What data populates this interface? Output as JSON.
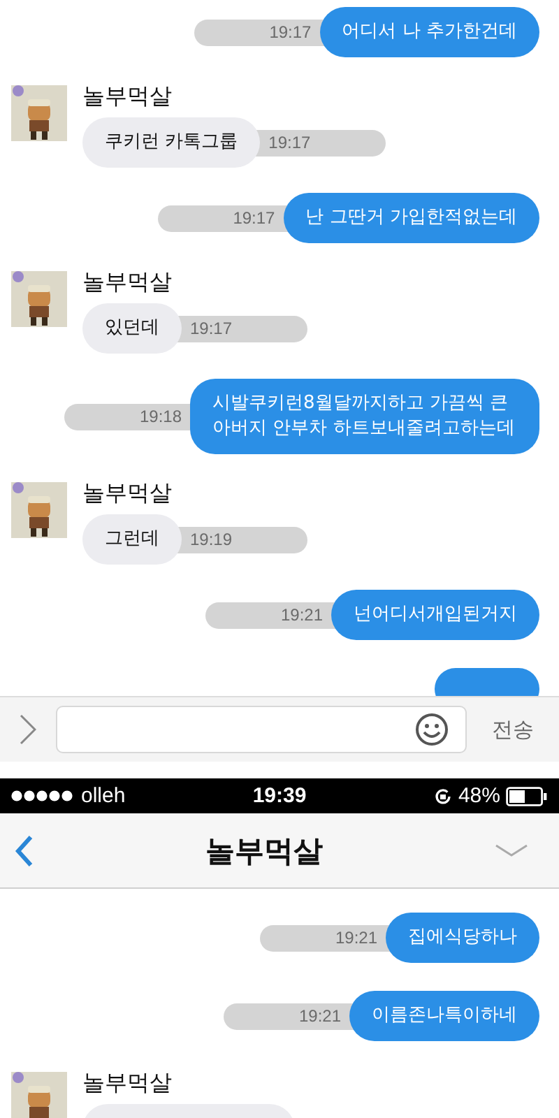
{
  "top_screen": {
    "messages": [
      {
        "kind": "sent",
        "text": "어디서 나 추가한건데",
        "time": "19:17"
      },
      {
        "kind": "received",
        "sender": "놀부먹살",
        "text": "쿠키런 카톡그룹",
        "time": "19:17"
      },
      {
        "kind": "sent",
        "text": "난 그딴거 가입한적없는데",
        "time": "19:17"
      },
      {
        "kind": "received",
        "sender": "놀부먹살",
        "text": "있던데",
        "time": "19:17"
      },
      {
        "kind": "sent",
        "text": "시발쿠키런8월달까지하고 가끔씩 큰 아버지 안부차 하트보내줄려고하는데",
        "time": "19:18"
      },
      {
        "kind": "received",
        "sender": "놀부먹살",
        "text": "그런데",
        "time": "19:19"
      },
      {
        "kind": "sent",
        "text": "넌어디서개입된거지",
        "time": "19:21"
      },
      {
        "kind": "sent_cut"
      }
    ],
    "input_bar": {
      "send_label": "전송"
    }
  },
  "bottom_screen": {
    "status_bar": {
      "carrier": "olleh",
      "time": "19:39",
      "battery": "48%"
    },
    "nav": {
      "title": "놀부먹살"
    },
    "messages": [
      {
        "kind": "sent",
        "text": "집에식당하나",
        "time": "19:21"
      },
      {
        "kind": "sent",
        "text": "이름존나특이하네",
        "time": "19:21"
      },
      {
        "kind": "received_cut",
        "sender": "놀부먹살"
      }
    ]
  }
}
